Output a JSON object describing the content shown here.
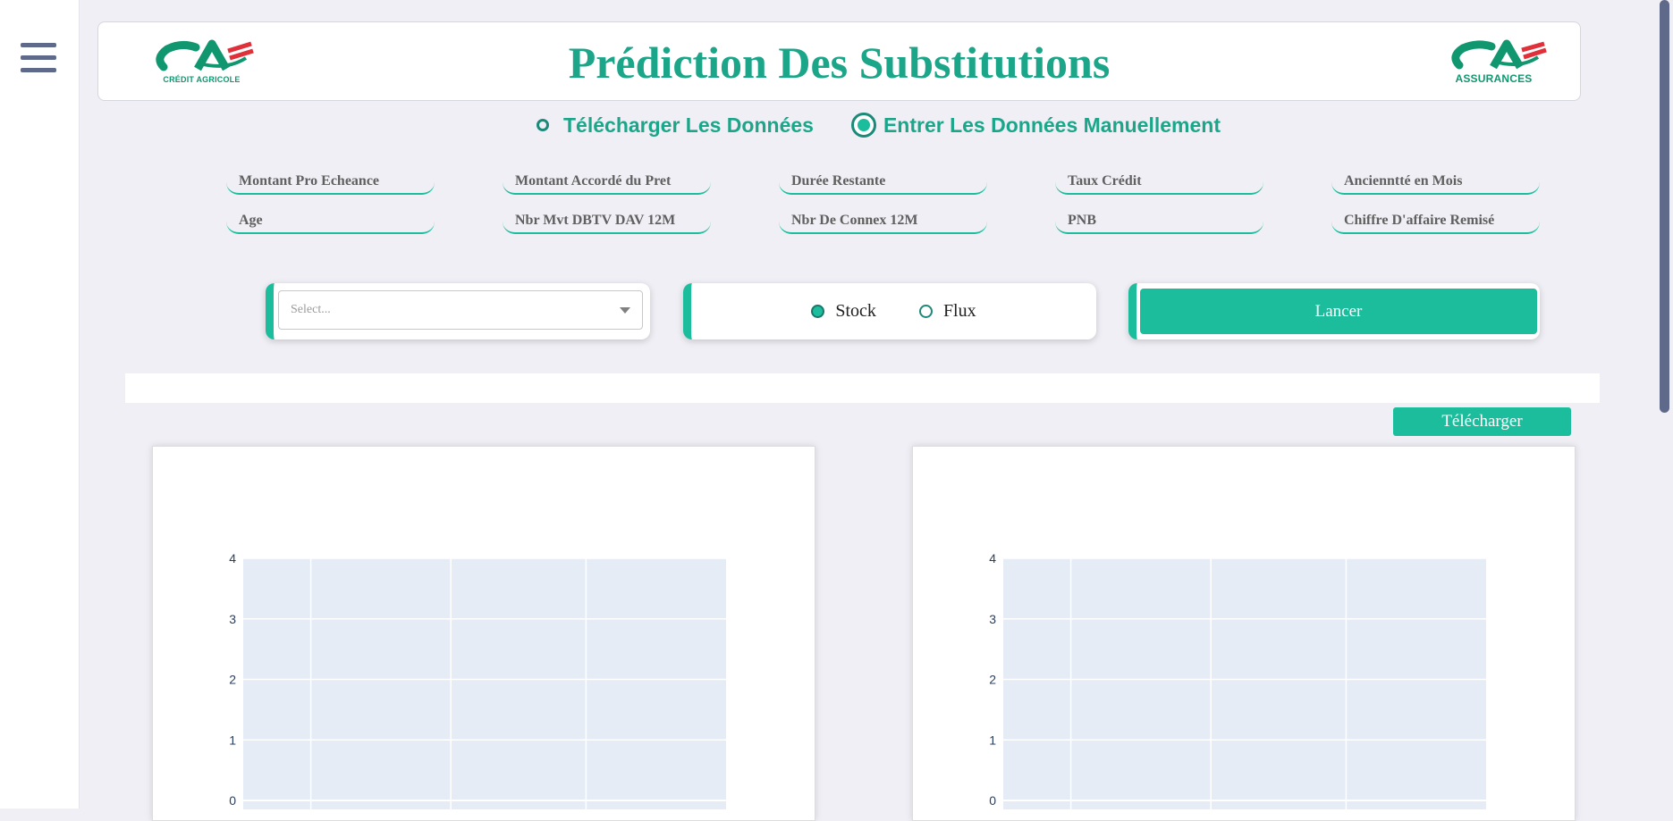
{
  "colors": {
    "accent": "#1bbd9c",
    "title": "#1ba68a",
    "sidebar_icon": "#5f6a8a",
    "plot_bg": "#e5ecf6"
  },
  "sidebar": {
    "menu_icon": "hamburger-icon"
  },
  "header": {
    "title": "Prédiction Des Substitutions",
    "logo_left": {
      "text": "CRÉDIT AGRICOLE",
      "icon": "credit-agricole-logo"
    },
    "logo_right": {
      "text": "ASSURANCES",
      "icon": "credit-agricole-assurances-logo"
    }
  },
  "mode": {
    "options": [
      "Télécharger Les Données",
      "Entrer Les Données Manuellement"
    ],
    "selected": "Entrer Les Données Manuellement"
  },
  "fields": [
    [
      "Montant Pro Echeance",
      "Montant Accordé du Pret",
      "Durée Restante",
      "Taux Crédit",
      "Ancienntté en Mois"
    ],
    [
      "Age",
      "Nbr Mvt DBTV DAV 12M",
      "Nbr De Connex 12M",
      "PNB",
      "Chiffre D'affaire Remisé"
    ]
  ],
  "controls": {
    "select_placeholder": "Select...",
    "type_options": [
      "Stock",
      "Flux"
    ],
    "type_selected": "Stock",
    "launch_label": "Lancer"
  },
  "download_label": "Télécharger",
  "chart_data": [
    {
      "type": "bar",
      "title": "",
      "xlabel": "",
      "ylabel": "",
      "ylim": [
        0,
        4
      ],
      "yticks": [
        "0",
        "1",
        "2",
        "3",
        "4"
      ],
      "series": [],
      "grid": true
    },
    {
      "type": "bar",
      "title": "",
      "xlabel": "",
      "ylabel": "",
      "ylim": [
        0,
        4
      ],
      "yticks": [
        "0",
        "1",
        "2",
        "3",
        "4"
      ],
      "series": [],
      "grid": true
    }
  ]
}
